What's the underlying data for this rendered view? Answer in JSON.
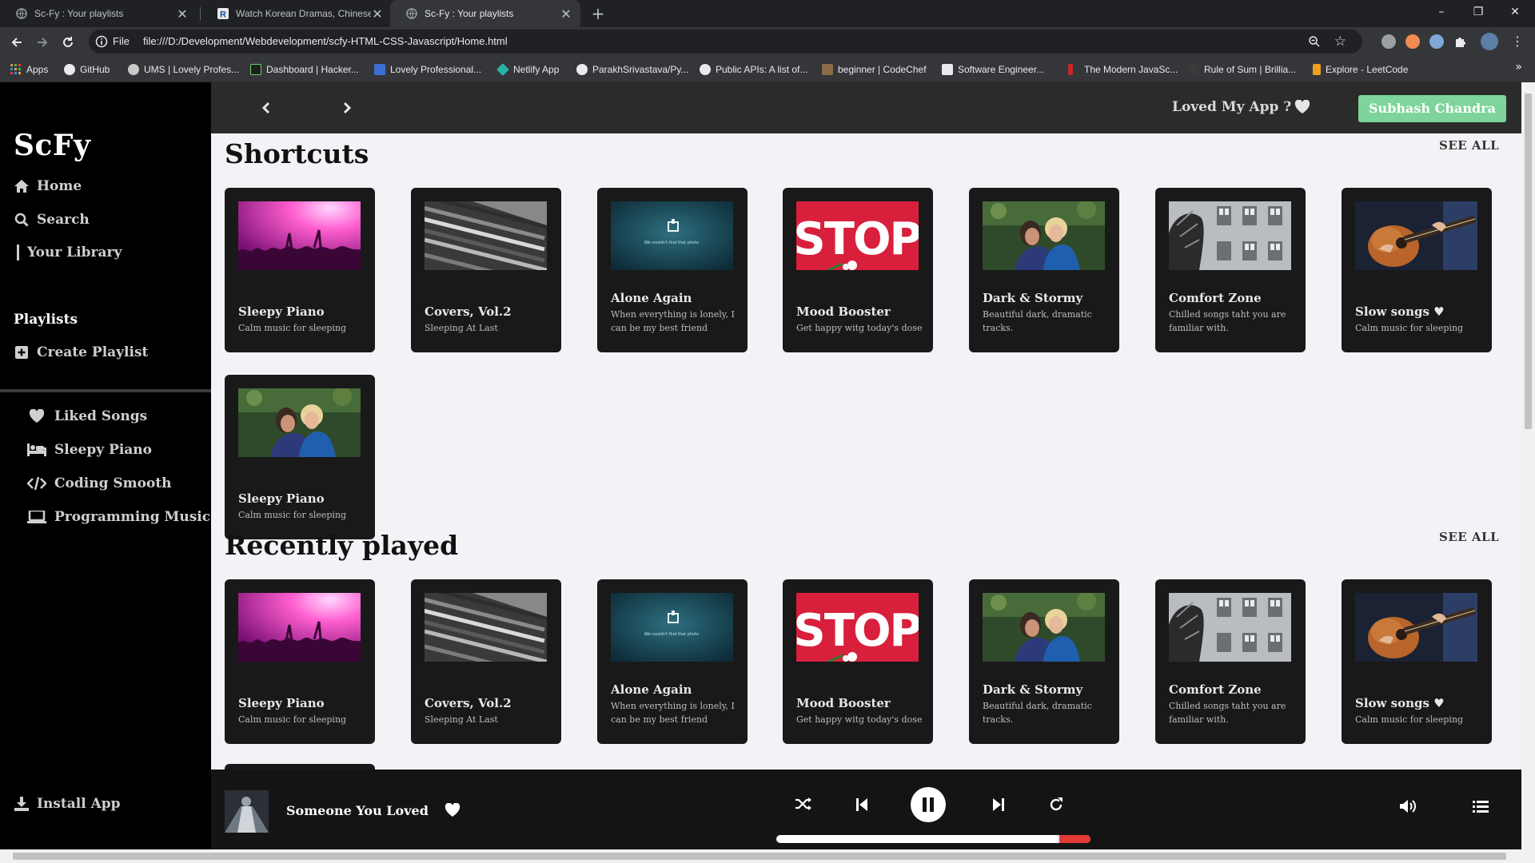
{
  "browser": {
    "tabs": [
      {
        "title": "Sc-Fy : Your playlists",
        "active": false
      },
      {
        "title": "Watch Korean Dramas, Chinese D",
        "active": false
      },
      {
        "title": "Sc-Fy : Your playlists",
        "active": true
      }
    ],
    "new_tab": "+",
    "window_controls": {
      "minimize": "–",
      "restore": "❐",
      "close": "✕"
    },
    "address": {
      "scheme_label": "File",
      "url": "file:///D:/Development/Webdevelopment/scfy-HTML-CSS-Javascript/Home.html"
    },
    "bookmarks": [
      "Apps",
      "GitHub",
      "UMS | Lovely Profes...",
      "Dashboard | Hacker...",
      "Lovely Professional...",
      "Netlify App",
      "ParakhSrivastava/Py...",
      "Public APIs: A list of...",
      "beginner | CodeChef",
      "Software Engineer...",
      "The Modern JavaSc...",
      "Rule of Sum | Brillia...",
      "Explore - LeetCode"
    ],
    "bookmarks_more": "»"
  },
  "app": {
    "logo": "ScFy",
    "nav": [
      {
        "label": "Home",
        "icon": "home-icon"
      },
      {
        "label": "Search",
        "icon": "search-icon"
      },
      {
        "label": "Your Library",
        "icon": "library-icon"
      }
    ],
    "playlists_title": "Playlists",
    "create_playlist": "Create Playlist",
    "playlist_links": [
      {
        "label": "Liked Songs",
        "icon": "heart-icon"
      },
      {
        "label": "Sleepy Piano",
        "icon": "bed-icon"
      },
      {
        "label": "Coding Smooth",
        "icon": "code-icon"
      },
      {
        "label": "Programming Music",
        "icon": "laptop-icon"
      }
    ],
    "install_app": "Install App",
    "topbar": {
      "loved_label": "Loved My App ?",
      "user_name": "Subhash Chandra"
    },
    "sections": [
      {
        "title": "Shortcuts",
        "see_all": "SEE ALL",
        "cards": [
          {
            "title": "Sleepy Piano",
            "subtitle": "Calm music for sleeping",
            "art": "concert"
          },
          {
            "title": "Covers, Vol.2",
            "subtitle": "Sleeping At Last",
            "art": "records"
          },
          {
            "title": "Alone Again",
            "subtitle": "When everything is lonely, I can be my best friend",
            "art": "missing"
          },
          {
            "title": "Mood Booster",
            "subtitle": "Get happy witg today's dose",
            "art": "stop"
          },
          {
            "title": "Dark & Stormy",
            "subtitle": "Beautiful dark, dramatic tracks.",
            "art": "couple"
          },
          {
            "title": "Comfort Zone",
            "subtitle": "Chilled songs taht you are familiar with.",
            "art": "building"
          },
          {
            "title": "Slow songs ♥",
            "subtitle": "Calm music for sleeping",
            "art": "guitar"
          },
          {
            "title": "Sleepy Piano",
            "subtitle": "Calm music for sleeping",
            "art": "couple"
          }
        ]
      },
      {
        "title": "Recently played",
        "see_all": "SEE ALL",
        "cards": [
          {
            "title": "Sleepy Piano",
            "subtitle": "Calm music for sleeping",
            "art": "concert"
          },
          {
            "title": "Covers, Vol.2",
            "subtitle": "Sleeping At Last",
            "art": "records"
          },
          {
            "title": "Alone Again",
            "subtitle": "When everything is lonely, I can be my best friend",
            "art": "missing"
          },
          {
            "title": "Mood Booster",
            "subtitle": "Get happy witg today's dose",
            "art": "stop"
          },
          {
            "title": "Dark & Stormy",
            "subtitle": "Beautiful dark, dramatic tracks.",
            "art": "couple"
          },
          {
            "title": "Comfort Zone",
            "subtitle": "Chilled songs taht you are familiar with.",
            "art": "building"
          },
          {
            "title": "Slow songs ♥",
            "subtitle": "Calm music for sleeping",
            "art": "guitar"
          }
        ]
      }
    ],
    "art_text": {
      "stop_sign": "STOP",
      "missing_photo": "We couldn't find that photo"
    },
    "player": {
      "song": "Someone You Loved",
      "progress": 0.9,
      "playing": true
    },
    "colors": {
      "accent": "#7ed49a",
      "sidebar": "#000000",
      "card": "#191919",
      "content_bg": "#f3f3f7",
      "progress_end": "#e53935"
    }
  }
}
